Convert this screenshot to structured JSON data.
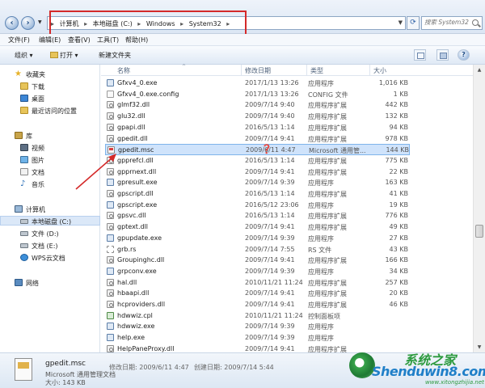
{
  "address": {
    "crumbs": [
      "计算机",
      "本地磁盘 (C:)",
      "Windows",
      "System32"
    ],
    "search_placeholder": "搜索 System32"
  },
  "menu": [
    "文件(F)",
    "编辑(E)",
    "查看(V)",
    "工具(T)",
    "帮助(H)"
  ],
  "toolbar": {
    "organize": "组织 ▾",
    "open": "打开 ▾",
    "new_folder": "新建文件夹"
  },
  "nav": {
    "favorites": "收藏夹",
    "downloads": "下载",
    "desktop": "桌面",
    "recent": "最近访问的位置",
    "libraries": "库",
    "videos": "视频",
    "pictures": "图片",
    "documents": "文档",
    "music": "音乐",
    "computer": "计算机",
    "drive_c": "本地磁盘 (C:)",
    "drive_d": "文件 (D:)",
    "drive_e": "文档 (E:)",
    "wps": "WPS云文档",
    "network": "网络"
  },
  "columns": {
    "name": "名称",
    "date": "修改日期",
    "type": "类型",
    "size": "大小"
  },
  "files": [
    {
      "name": "Gfxv4_0.exe",
      "date": "2017/1/13 13:26",
      "type": "应用程序",
      "size": "1,016 KB",
      "kind": "exe"
    },
    {
      "name": "Gfxv4_0.exe.config",
      "date": "2017/1/13 13:26",
      "type": "CONFIG 文件",
      "size": "1 KB",
      "kind": "cfg"
    },
    {
      "name": "glmf32.dll",
      "date": "2009/7/14 9:40",
      "type": "应用程序扩展",
      "size": "442 KB",
      "kind": "dll"
    },
    {
      "name": "glu32.dll",
      "date": "2009/7/14 9:40",
      "type": "应用程序扩展",
      "size": "132 KB",
      "kind": "dll"
    },
    {
      "name": "gpapi.dll",
      "date": "2016/5/13 1:14",
      "type": "应用程序扩展",
      "size": "94 KB",
      "kind": "dll"
    },
    {
      "name": "gpedit.dll",
      "date": "2009/7/14 9:41",
      "type": "应用程序扩展",
      "size": "978 KB",
      "kind": "dll"
    },
    {
      "name": "gpedit.msc",
      "date": "2009/6/11 4:47",
      "type": "Microsoft 通用管...",
      "size": "144 KB",
      "kind": "msc"
    },
    {
      "name": "gpprefcl.dll",
      "date": "2016/5/13 1:14",
      "type": "应用程序扩展",
      "size": "775 KB",
      "kind": "dll"
    },
    {
      "name": "gpprnext.dll",
      "date": "2009/7/14 9:41",
      "type": "应用程序扩展",
      "size": "22 KB",
      "kind": "dll"
    },
    {
      "name": "gpresult.exe",
      "date": "2009/7/14 9:39",
      "type": "应用程序",
      "size": "163 KB",
      "kind": "exe"
    },
    {
      "name": "gpscript.dll",
      "date": "2016/5/13 1:14",
      "type": "应用程序扩展",
      "size": "41 KB",
      "kind": "dll"
    },
    {
      "name": "gpscript.exe",
      "date": "2016/5/12 23:06",
      "type": "应用程序",
      "size": "19 KB",
      "kind": "exe"
    },
    {
      "name": "gpsvc.dll",
      "date": "2016/5/13 1:14",
      "type": "应用程序扩展",
      "size": "776 KB",
      "kind": "dll"
    },
    {
      "name": "gptext.dll",
      "date": "2009/7/14 9:41",
      "type": "应用程序扩展",
      "size": "49 KB",
      "kind": "dll"
    },
    {
      "name": "gpupdate.exe",
      "date": "2009/7/14 9:39",
      "type": "应用程序",
      "size": "27 KB",
      "kind": "exe"
    },
    {
      "name": "grb.rs",
      "date": "2009/7/14 7:55",
      "type": "RS 文件",
      "size": "43 KB",
      "kind": "rs"
    },
    {
      "name": "Groupinghc.dll",
      "date": "2009/7/14 9:41",
      "type": "应用程序扩展",
      "size": "166 KB",
      "kind": "dll"
    },
    {
      "name": "grpconv.exe",
      "date": "2009/7/14 9:39",
      "type": "应用程序",
      "size": "34 KB",
      "kind": "exe"
    },
    {
      "name": "hal.dll",
      "date": "2010/11/21 11:24",
      "type": "应用程序扩展",
      "size": "257 KB",
      "kind": "dll"
    },
    {
      "name": "hbaapi.dll",
      "date": "2009/7/14 9:41",
      "type": "应用程序扩展",
      "size": "20 KB",
      "kind": "dll"
    },
    {
      "name": "hcproviders.dll",
      "date": "2009/7/14 9:41",
      "type": "应用程序扩展",
      "size": "46 KB",
      "kind": "dll"
    },
    {
      "name": "hdwwiz.cpl",
      "date": "2010/11/21 11:24",
      "type": "控制面板项",
      "size": "",
      "kind": "cpl"
    },
    {
      "name": "hdwwiz.exe",
      "date": "2009/7/14 9:39",
      "type": "应用程序",
      "size": "",
      "kind": "exe"
    },
    {
      "name": "help.exe",
      "date": "2009/7/14 9:39",
      "type": "应用程序",
      "size": "",
      "kind": "exe"
    },
    {
      "name": "HelpPaneProxy.dll",
      "date": "2009/7/14 9:41",
      "type": "应用程序扩展",
      "size": "",
      "kind": "dll"
    }
  ],
  "selected_index": 6,
  "details": {
    "name": "gpedit.msc",
    "modified_label": "修改日期: 2009/6/11 4:47",
    "created_label": "创建日期: 2009/7/14 5:44",
    "type": "Microsoft 通用管理文档",
    "size": "大小: 143 KB"
  },
  "watermark": {
    "chinese": "系统之家",
    "brand": "Shenduwin8.com",
    "url": "www.xitongzhijia.net"
  },
  "colors": {
    "annotation_red": "#d42a2a",
    "selection": "#cfe3fb"
  }
}
